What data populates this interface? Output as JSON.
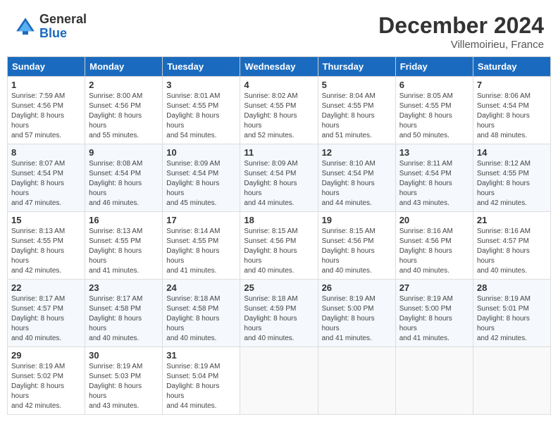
{
  "header": {
    "logo_general": "General",
    "logo_blue": "Blue",
    "title": "December 2024",
    "location": "Villemoirieu, France"
  },
  "columns": [
    "Sunday",
    "Monday",
    "Tuesday",
    "Wednesday",
    "Thursday",
    "Friday",
    "Saturday"
  ],
  "weeks": [
    [
      {
        "day": "1",
        "sunrise": "7:59 AM",
        "sunset": "4:56 PM",
        "daylight": "8 hours and 57 minutes."
      },
      {
        "day": "2",
        "sunrise": "8:00 AM",
        "sunset": "4:56 PM",
        "daylight": "8 hours and 55 minutes."
      },
      {
        "day": "3",
        "sunrise": "8:01 AM",
        "sunset": "4:55 PM",
        "daylight": "8 hours and 54 minutes."
      },
      {
        "day": "4",
        "sunrise": "8:02 AM",
        "sunset": "4:55 PM",
        "daylight": "8 hours and 52 minutes."
      },
      {
        "day": "5",
        "sunrise": "8:04 AM",
        "sunset": "4:55 PM",
        "daylight": "8 hours and 51 minutes."
      },
      {
        "day": "6",
        "sunrise": "8:05 AM",
        "sunset": "4:55 PM",
        "daylight": "8 hours and 50 minutes."
      },
      {
        "day": "7",
        "sunrise": "8:06 AM",
        "sunset": "4:54 PM",
        "daylight": "8 hours and 48 minutes."
      }
    ],
    [
      {
        "day": "8",
        "sunrise": "8:07 AM",
        "sunset": "4:54 PM",
        "daylight": "8 hours and 47 minutes."
      },
      {
        "day": "9",
        "sunrise": "8:08 AM",
        "sunset": "4:54 PM",
        "daylight": "8 hours and 46 minutes."
      },
      {
        "day": "10",
        "sunrise": "8:09 AM",
        "sunset": "4:54 PM",
        "daylight": "8 hours and 45 minutes."
      },
      {
        "day": "11",
        "sunrise": "8:09 AM",
        "sunset": "4:54 PM",
        "daylight": "8 hours and 44 minutes."
      },
      {
        "day": "12",
        "sunrise": "8:10 AM",
        "sunset": "4:54 PM",
        "daylight": "8 hours and 44 minutes."
      },
      {
        "day": "13",
        "sunrise": "8:11 AM",
        "sunset": "4:54 PM",
        "daylight": "8 hours and 43 minutes."
      },
      {
        "day": "14",
        "sunrise": "8:12 AM",
        "sunset": "4:55 PM",
        "daylight": "8 hours and 42 minutes."
      }
    ],
    [
      {
        "day": "15",
        "sunrise": "8:13 AM",
        "sunset": "4:55 PM",
        "daylight": "8 hours and 42 minutes."
      },
      {
        "day": "16",
        "sunrise": "8:13 AM",
        "sunset": "4:55 PM",
        "daylight": "8 hours and 41 minutes."
      },
      {
        "day": "17",
        "sunrise": "8:14 AM",
        "sunset": "4:55 PM",
        "daylight": "8 hours and 41 minutes."
      },
      {
        "day": "18",
        "sunrise": "8:15 AM",
        "sunset": "4:56 PM",
        "daylight": "8 hours and 40 minutes."
      },
      {
        "day": "19",
        "sunrise": "8:15 AM",
        "sunset": "4:56 PM",
        "daylight": "8 hours and 40 minutes."
      },
      {
        "day": "20",
        "sunrise": "8:16 AM",
        "sunset": "4:56 PM",
        "daylight": "8 hours and 40 minutes."
      },
      {
        "day": "21",
        "sunrise": "8:16 AM",
        "sunset": "4:57 PM",
        "daylight": "8 hours and 40 minutes."
      }
    ],
    [
      {
        "day": "22",
        "sunrise": "8:17 AM",
        "sunset": "4:57 PM",
        "daylight": "8 hours and 40 minutes."
      },
      {
        "day": "23",
        "sunrise": "8:17 AM",
        "sunset": "4:58 PM",
        "daylight": "8 hours and 40 minutes."
      },
      {
        "day": "24",
        "sunrise": "8:18 AM",
        "sunset": "4:58 PM",
        "daylight": "8 hours and 40 minutes."
      },
      {
        "day": "25",
        "sunrise": "8:18 AM",
        "sunset": "4:59 PM",
        "daylight": "8 hours and 40 minutes."
      },
      {
        "day": "26",
        "sunrise": "8:19 AM",
        "sunset": "5:00 PM",
        "daylight": "8 hours and 41 minutes."
      },
      {
        "day": "27",
        "sunrise": "8:19 AM",
        "sunset": "5:00 PM",
        "daylight": "8 hours and 41 minutes."
      },
      {
        "day": "28",
        "sunrise": "8:19 AM",
        "sunset": "5:01 PM",
        "daylight": "8 hours and 42 minutes."
      }
    ],
    [
      {
        "day": "29",
        "sunrise": "8:19 AM",
        "sunset": "5:02 PM",
        "daylight": "8 hours and 42 minutes."
      },
      {
        "day": "30",
        "sunrise": "8:19 AM",
        "sunset": "5:03 PM",
        "daylight": "8 hours and 43 minutes."
      },
      {
        "day": "31",
        "sunrise": "8:19 AM",
        "sunset": "5:04 PM",
        "daylight": "8 hours and 44 minutes."
      },
      null,
      null,
      null,
      null
    ]
  ]
}
